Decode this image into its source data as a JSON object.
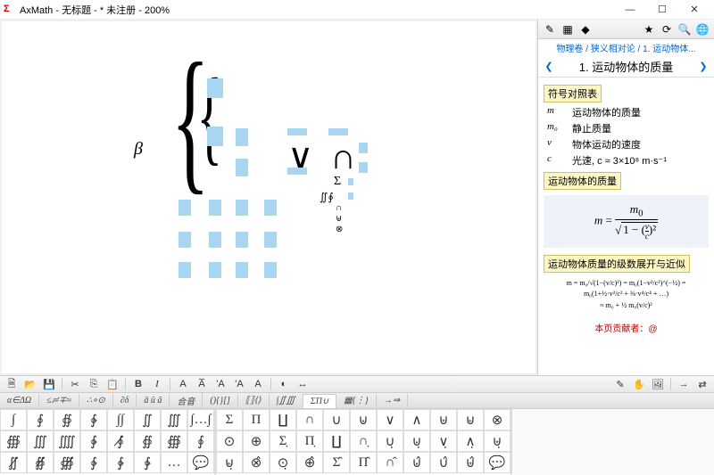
{
  "titlebar": {
    "app_icon": "Σ",
    "title": "AxMath - 无标题 - * 未注册 - 200%"
  },
  "winbtns": {
    "min": "—",
    "max": "☐",
    "close": "✕"
  },
  "side_toolbar": {
    "b1": "✎",
    "b2": "▦",
    "b3": "◆",
    "b4": "★",
    "b5": "⟳",
    "b6": "🔍",
    "b7": "🌐"
  },
  "breadcrumb": "物理卷 / 狭义相对论 / 1. 运动物体...",
  "side_title": "1. 运动物体的质量",
  "sections": {
    "s1": "符号对照表",
    "s2": "运动物体的质量",
    "s3": "运动物体质量的级数展开与近似"
  },
  "symbols": [
    {
      "sym": "m",
      "desc": "运动物体的质量"
    },
    {
      "sym": "m₀",
      "desc": "静止质量"
    },
    {
      "sym": "v",
      "desc": "物体运动的速度"
    },
    {
      "sym": "c",
      "desc": "光速, c ≈ 3×10⁸ m·s⁻¹"
    }
  ],
  "formula_main": "m = m₀ / √(1 − (v/c)²)",
  "formula_small1": "m = m₀/√(1−(v/c)²) = m₀(1−v²/c²)^(−½) = m₀(1+½·v²/c² + ⅜·v⁴/c⁴ + …)",
  "formula_small2": "≈ m₀ + ½ m₀(v/c)²",
  "contrib": "本页贡献者：@",
  "toolstrip": {
    "new": "🗎",
    "open": "📂",
    "save": "💾",
    "cut": "✂",
    "copy": "⎘",
    "paste": "📋",
    "bold": "B",
    "italic": "I",
    "a1": "A",
    "a2": "A̅",
    "a3": "'A",
    "a4": "'A",
    "a5": "A",
    "grp1": "◐",
    "grp2": "↔",
    "pencil": "✎",
    "hand": "✋",
    "img": "🖼",
    "arr": "→",
    "arr2": "⇄"
  },
  "tabs": [
    "α∈ΔΩ",
    "≤≓∓≈",
    "∴∘⊙",
    "∂δ",
    "ā ü ã",
    "合音",
    "(){}[]",
    "⟦⟧⟨⟩",
    "∫∬∭",
    "ΣΠ∪",
    "▦{⋮}",
    "→⇒"
  ],
  "palette_left": [
    [
      "∫",
      "∮",
      "∯",
      "∲",
      "∫∫",
      "∬",
      "∭",
      "∫…∫"
    ],
    [
      "∰",
      "∭",
      "⨌",
      "∳",
      "∮̸",
      "∯",
      "∰",
      "∮"
    ],
    [
      "∬̸",
      "∯̸",
      "∰̸",
      "∲",
      "∲",
      "∳",
      "…",
      "💬"
    ]
  ],
  "palette_right": [
    [
      "Σ",
      "Π",
      "∐",
      "∩",
      "∪",
      "⊍",
      "∨",
      "∧",
      "⊎",
      "⊌",
      "⊗"
    ],
    [
      "⊙",
      "⊕",
      "Σ̣",
      "Π̣",
      "∐̣",
      "∩̣",
      "∪̣",
      "⊍̣",
      "∨̣",
      "∧̣",
      "⊎̣"
    ],
    [
      "⊌̣",
      "⊗̂",
      "⊙̣",
      "⊕̂",
      "Σ̂",
      "Π̂",
      "∩̂",
      "⊍̂",
      "∪̂",
      "⊎̂",
      "💬"
    ]
  ],
  "canvas_symbols": {
    "beta": "β",
    "vee": "∨",
    "cap": "∩",
    "sigma": "Σ",
    "intint": "∬∮",
    "cap2": "∩",
    "cup": "⊎",
    "otimes": "⊗"
  }
}
